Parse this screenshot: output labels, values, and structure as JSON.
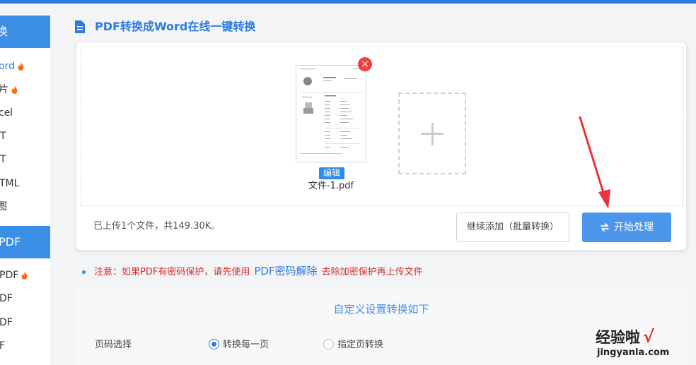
{
  "sidebar": {
    "headers": [
      {
        "label": "换",
        "key": "h1"
      },
      {
        "label": "PDF",
        "key": "h2"
      }
    ],
    "items": [
      {
        "label": "ord",
        "hot": true,
        "active": true
      },
      {
        "label": "片",
        "hot": true,
        "active": false
      },
      {
        "label": "cel",
        "hot": false,
        "active": false
      },
      {
        "label": "T",
        "hot": false,
        "active": false
      },
      {
        "label": "T",
        "hot": false,
        "active": false
      },
      {
        "label": "TML",
        "hot": false,
        "active": false
      },
      {
        "label": "图",
        "hot": false,
        "active": false
      },
      {
        "label": "PDF",
        "hot": true,
        "active": false
      },
      {
        "label": "DF",
        "hot": false,
        "active": false
      },
      {
        "label": "DF",
        "hot": false,
        "active": false
      },
      {
        "label": "F",
        "hot": false,
        "active": false
      }
    ]
  },
  "page": {
    "title": "PDF转换成Word在线一键转换"
  },
  "upload": {
    "file_name": "文件-1.pdf",
    "edit_label": "编辑",
    "remove_symbol": "×",
    "status": "已上传1个文件，共149.30K。",
    "continue_label": "继续添加（批量转换）",
    "start_label": "开始处理"
  },
  "notice": {
    "prefix": "注意：如果PDF有密码保护，请先使用",
    "link": "PDF密码解除",
    "suffix": "去除加密保护再上传文件"
  },
  "settings": {
    "title": "自定义设置转换如下",
    "page_select_label": "页码选择",
    "options": [
      {
        "label": "转换每一页",
        "checked": true
      },
      {
        "label": "指定页转换",
        "checked": false
      }
    ]
  },
  "watermark": {
    "main": "经验啦",
    "check": "√",
    "sub": "jingyanla.com"
  },
  "colors": {
    "accent": "#2e7be0",
    "header_bg": "#3b8fe6",
    "start_button": "#4c97ec",
    "remove_button": "#f04040",
    "notice_text": "#d92b2b",
    "arrow": "#e8343a"
  },
  "icons": {
    "title": "document-icon",
    "hot": "fire-icon",
    "start": "swap-icon",
    "add": "plus-icon",
    "remove": "close-icon"
  }
}
